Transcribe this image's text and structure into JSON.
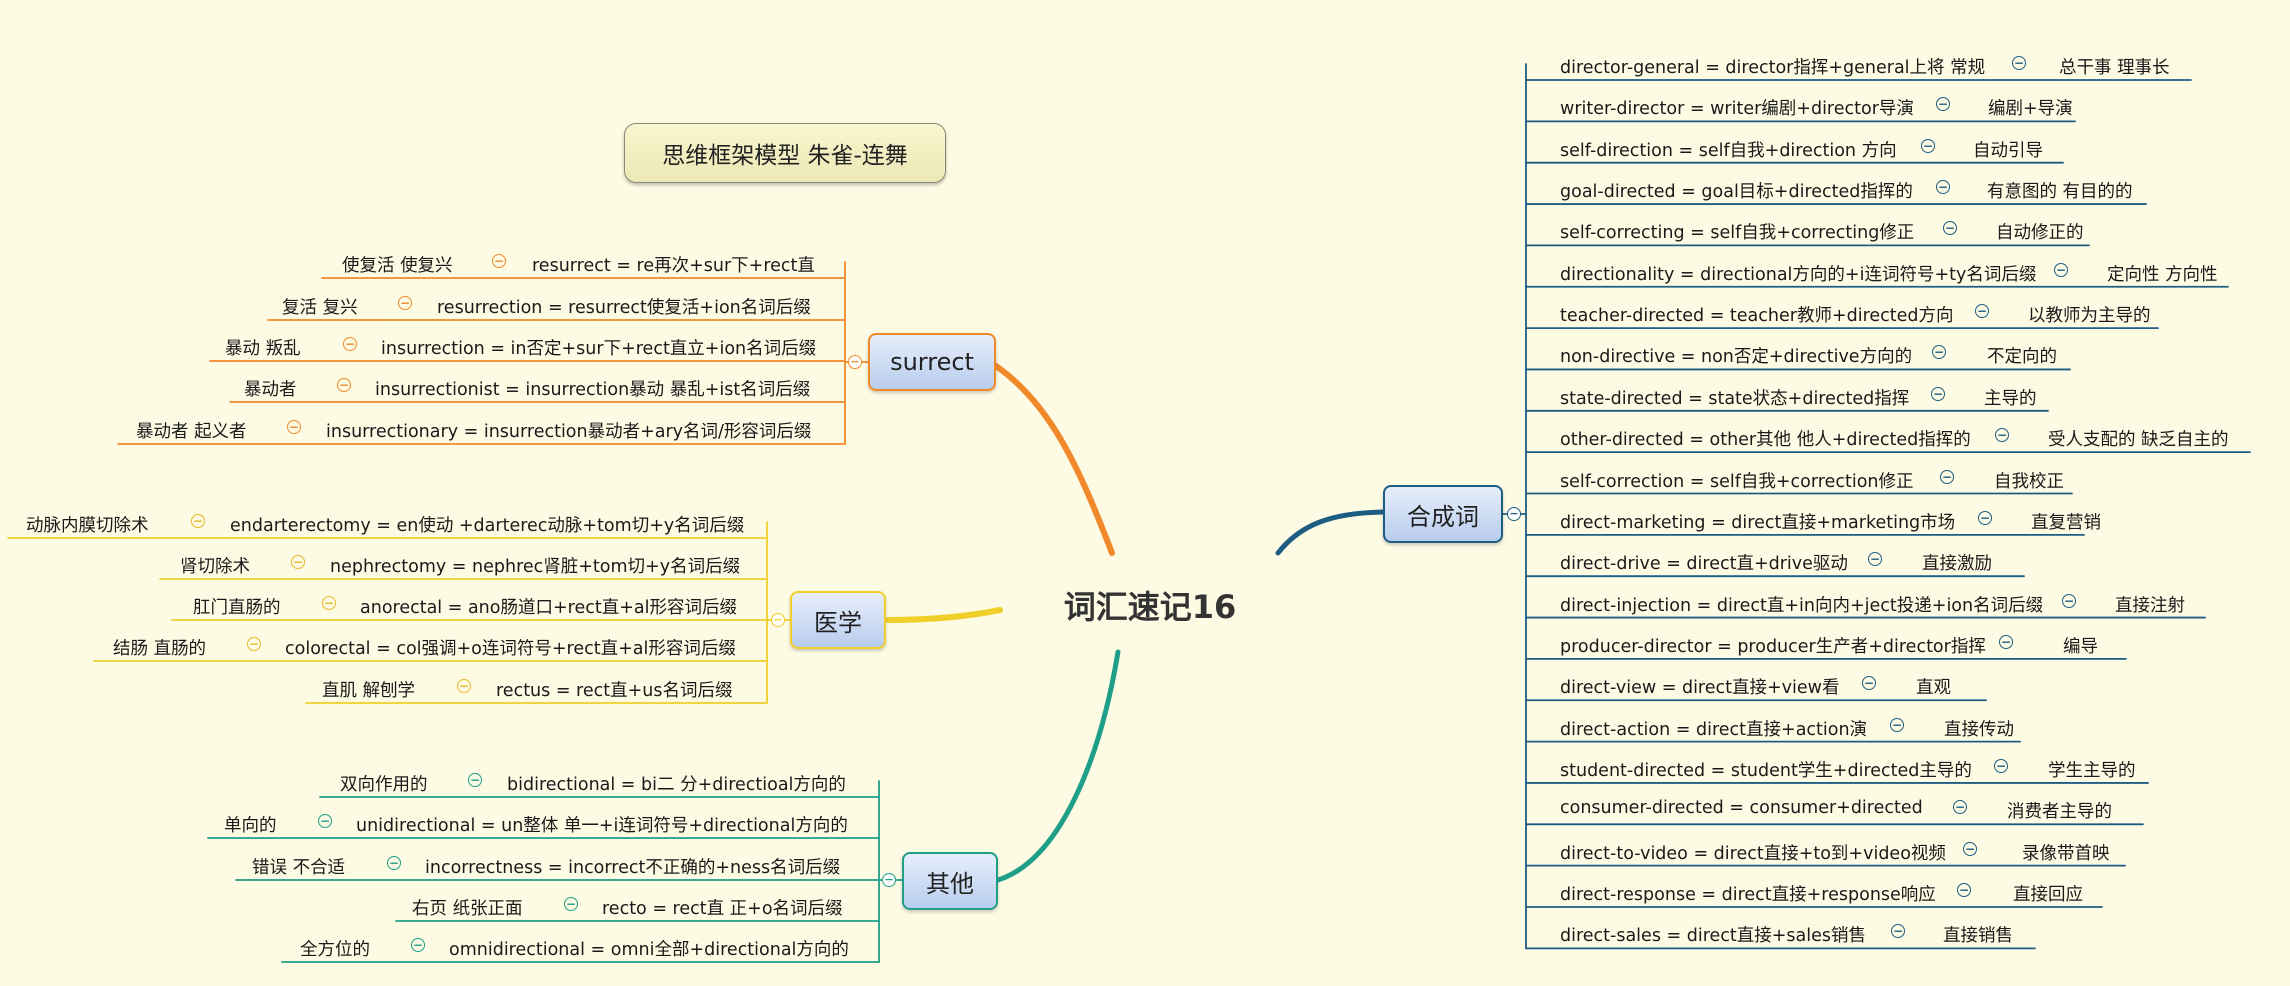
{
  "title": "思维框架模型 朱雀-连舞",
  "center": "词汇速记16",
  "collapse_symbol": "−",
  "colors": {
    "surrect": "#f0892a",
    "yixue": "#f1cf2b",
    "qita": "#1f9e88",
    "hecheng": "#1d5d83",
    "background": "#fdfbe3"
  },
  "branches": {
    "surrect": {
      "label": "surrect",
      "items": [
        {
          "meaning": "使复活 使复兴",
          "formula": "resurrect = re再次+sur下+rect直"
        },
        {
          "meaning": "复活 复兴",
          "formula": "resurrection = resurrect使复活+ion名词后缀"
        },
        {
          "meaning": "暴动 叛乱",
          "formula": "insurrection = in否定+sur下+rect直立+ion名词后缀"
        },
        {
          "meaning": "暴动者",
          "formula": "insurrectionist = insurrection暴动 暴乱+ist名词后缀"
        },
        {
          "meaning": "暴动者 起义者",
          "formula": "insurrectionary = insurrection暴动者+ary名词/形容词后缀"
        }
      ]
    },
    "yixue": {
      "label": "医学",
      "items": [
        {
          "meaning": "动脉内膜切除术",
          "formula": "endarterectomy = en使动 +darterec动脉+tom切+y名词后缀"
        },
        {
          "meaning": "肾切除术",
          "formula": "nephrectomy = nephrec肾脏+tom切+y名词后缀"
        },
        {
          "meaning": "肛门直肠的",
          "formula": "anorectal = ano肠道口+rect直+al形容词后缀"
        },
        {
          "meaning": "结肠 直肠的",
          "formula": "colorectal = col强调+o连词符号+rect直+al形容词后缀"
        },
        {
          "meaning": "直肌 解刨学",
          "formula": "rectus = rect直+us名词后缀"
        }
      ]
    },
    "qita": {
      "label": "其他",
      "items": [
        {
          "meaning": "双向作用的",
          "formula": "bidirectional = bi二 分+directioal方向的"
        },
        {
          "meaning": "单向的",
          "formula": "unidirectional = un整体 单一+i连词符号+directional方向的"
        },
        {
          "meaning": "错误 不合适",
          "formula": "incorrectness = incorrect不正确的+ness名词后缀"
        },
        {
          "meaning": "右页 纸张正面",
          "formula": "recto = rect直 正+o名词后缀"
        },
        {
          "meaning": "全方位的",
          "formula": "omnidirectional = omni全部+directional方向的"
        }
      ]
    },
    "hecheng": {
      "label": "合成词",
      "items": [
        {
          "formula": "director-general = director指挥+general上将 常规",
          "meaning": "总干事 理事长"
        },
        {
          "formula": "writer-director = writer编剧+director导演",
          "meaning": "编剧+导演"
        },
        {
          "formula": "self-direction = self自我+direction 方向",
          "meaning": "自动引导"
        },
        {
          "formula": "goal-directed = goal目标+directed指挥的",
          "meaning": "有意图的 有目的的"
        },
        {
          "formula": "self-correcting = self自我+correcting修正",
          "meaning": "自动修正的"
        },
        {
          "formula": "directionality = directional方向的+i连词符号+ty名词后缀",
          "meaning": "定向性 方向性"
        },
        {
          "formula": "teacher-directed = teacher教师+directed方向",
          "meaning": "以教师为主导的"
        },
        {
          "formula": "non-directive = non否定+directive方向的",
          "meaning": "不定向的"
        },
        {
          "formula": "state-directed = state状态+directed指挥",
          "meaning": "主导的"
        },
        {
          "formula": "other-directed = other其他 他人+directed指挥的",
          "meaning": "受人支配的 缺乏自主的"
        },
        {
          "formula": "self-correction = self自我+correction修正",
          "meaning": "自我校正"
        },
        {
          "formula": "direct-marketing  = direct直接+marketing市场",
          "meaning": "直复营销"
        },
        {
          "formula": "direct-drive = direct直+drive驱动",
          "meaning": "直接激励"
        },
        {
          "formula": "direct-injection = direct直+in向内+ject投递+ion名词后缀",
          "meaning": "直接注射"
        },
        {
          "formula": "producer-director = producer生产者+director指挥",
          "meaning": "编导"
        },
        {
          "formula": "direct-view = direct直接+view看",
          "meaning": "直观"
        },
        {
          "formula": "direct-action = direct直接+action演",
          "meaning": "直接传动"
        },
        {
          "formula": "student-directed = student学生+directed主导的",
          "meaning": "学生主导的"
        },
        {
          "formula": "consumer-directed  = consumer+directed",
          "meaning": "消费者主导的"
        },
        {
          "formula": "direct-to-video = direct直接+to到+video视频",
          "meaning": "录像带首映"
        },
        {
          "formula": "direct-response = direct直接+response响应",
          "meaning": "直接回应"
        },
        {
          "formula": "direct-sales = direct直接+sales销售",
          "meaning": "直接销售"
        }
      ]
    }
  }
}
